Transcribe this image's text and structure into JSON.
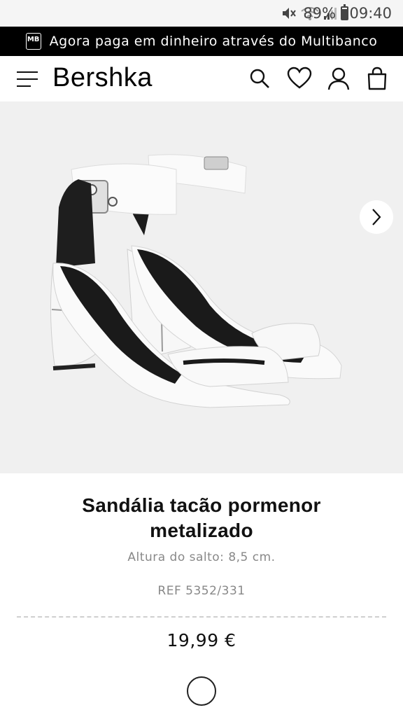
{
  "status_bar": {
    "battery_percent": "89%",
    "battery_level": 0.89,
    "time": "09:40",
    "icons": [
      "mute-icon",
      "wifi-icon",
      "signal-icon",
      "battery-icon"
    ]
  },
  "promo": {
    "logo_text": "MB",
    "text": "Agora paga em dinheiro através do Multibanco"
  },
  "header": {
    "brand": "Bershka",
    "icons": [
      "menu-icon",
      "search-icon",
      "heart-icon",
      "user-icon",
      "bag-icon"
    ]
  },
  "product": {
    "image_alt_icon": "sandal-image",
    "next_icon": "chevron-right-icon",
    "title": "Sandália tacão pormenor metalizado",
    "subtitle": "Altura do salto: 8,5 cm.",
    "ref": "REF 5352/331",
    "price": "19,99 €",
    "selected_color": "#ffffff"
  },
  "colors": {
    "banner_bg": "#000000",
    "hero_bg": "#f0f0f0",
    "text_muted": "#888888"
  }
}
